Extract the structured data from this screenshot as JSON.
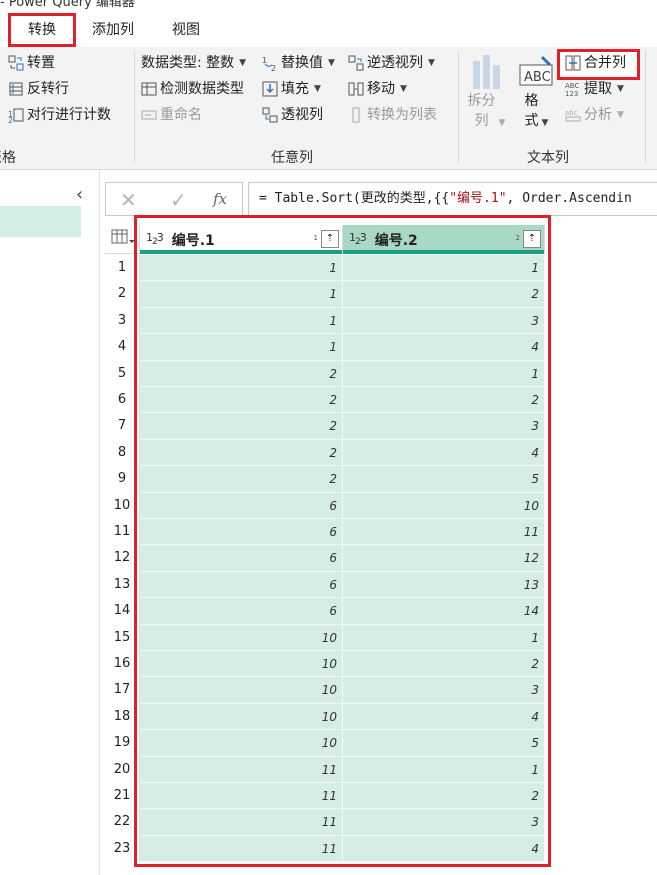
{
  "window": {
    "title": "- Power Query 编辑器"
  },
  "tabs": [
    {
      "label": "转换",
      "active": true
    },
    {
      "label": "添加列",
      "active": false
    },
    {
      "label": "视图",
      "active": false
    }
  ],
  "ribbon": {
    "table_group": {
      "label": "表格",
      "transpose": "转置",
      "reverse_rows": "反转行",
      "count_rows": "对行进行计数"
    },
    "any_column_group": {
      "label": "任意列",
      "data_type": "数据类型: 整数",
      "detect_type": "检测数据类型",
      "rename": "重命名",
      "replace_values": "替换值",
      "fill": "填充",
      "pivot": "透视列",
      "unpivot": "逆透视列",
      "move": "移动",
      "to_list": "转换为列表"
    },
    "text_column_group": {
      "label": "文本列",
      "split_column": "拆分列",
      "format": "格式",
      "merge_columns": "合并列",
      "extract": "提取",
      "parse": "分析"
    }
  },
  "formula_bar": {
    "prefix": "= Table.Sort(更改的类型,{{",
    "str1": "\"编号.1\"",
    "suffix": ", Order.Ascendin"
  },
  "grid": {
    "columns": [
      {
        "type_icon": "123",
        "name": "编号.1",
        "sort_order": "1"
      },
      {
        "type_icon": "123",
        "name": "编号.2",
        "sort_order": "2"
      }
    ],
    "rows": [
      [
        "1",
        "1",
        "1"
      ],
      [
        "2",
        "1",
        "2"
      ],
      [
        "3",
        "1",
        "3"
      ],
      [
        "4",
        "1",
        "4"
      ],
      [
        "5",
        "2",
        "1"
      ],
      [
        "6",
        "2",
        "2"
      ],
      [
        "7",
        "2",
        "3"
      ],
      [
        "8",
        "2",
        "4"
      ],
      [
        "9",
        "2",
        "5"
      ],
      [
        "10",
        "6",
        "10"
      ],
      [
        "11",
        "6",
        "11"
      ],
      [
        "12",
        "6",
        "12"
      ],
      [
        "13",
        "6",
        "13"
      ],
      [
        "14",
        "6",
        "14"
      ],
      [
        "15",
        "10",
        "1"
      ],
      [
        "16",
        "10",
        "2"
      ],
      [
        "17",
        "10",
        "3"
      ],
      [
        "18",
        "10",
        "4"
      ],
      [
        "19",
        "10",
        "5"
      ],
      [
        "20",
        "11",
        "1"
      ],
      [
        "21",
        "11",
        "2"
      ],
      [
        "22",
        "11",
        "3"
      ],
      [
        "23",
        "11",
        "4"
      ]
    ]
  },
  "colors": {
    "highlight_red": "#e0202a",
    "header_accent": "#16a085",
    "cell_fill": "#d5ede3"
  }
}
